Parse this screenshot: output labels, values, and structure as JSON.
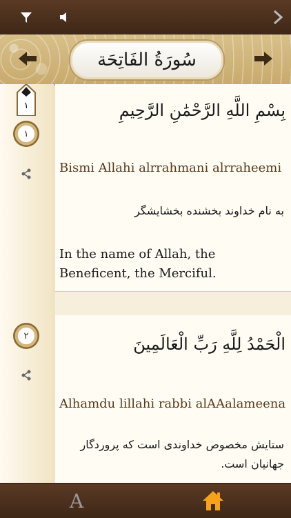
{
  "topbar": {
    "filter_icon": "filter-icon",
    "audio_icon": "speaker-icon",
    "next_icon": "chevron-right-icon"
  },
  "header": {
    "title": "سُورَةُ الفَاتِحَة",
    "prev_icon": "arrow-left-icon",
    "next_icon": "arrow-right-icon"
  },
  "juz_marker": "١",
  "verses": [
    {
      "number": "١",
      "arabic": "بِسْمِ اللَّهِ الرَّحْمَٰنِ الرَّحِيمِ",
      "transliteration": "Bismi Allahi alrrahmani alrraheemi",
      "persian": "به نام خداوند بخشنده بخشایشگر",
      "english": "In the name of Allah, the Beneficent, the Merciful."
    },
    {
      "number": "٢",
      "arabic": "الْحَمْدُ لِلَّهِ رَبِّ الْعَالَمِينَ",
      "transliteration": "Alhamdu lillahi rabbi alAAalameena",
      "persian": "ستایش مخصوص خداوندی است که پروردگار جهانیان است.",
      "english": ""
    }
  ],
  "bottombar": {
    "font_label": "A",
    "home_icon": "home-icon"
  },
  "colors": {
    "bar": "#4a2f1c",
    "accent": "#f7a21b",
    "gold": "#c8aa6c"
  }
}
